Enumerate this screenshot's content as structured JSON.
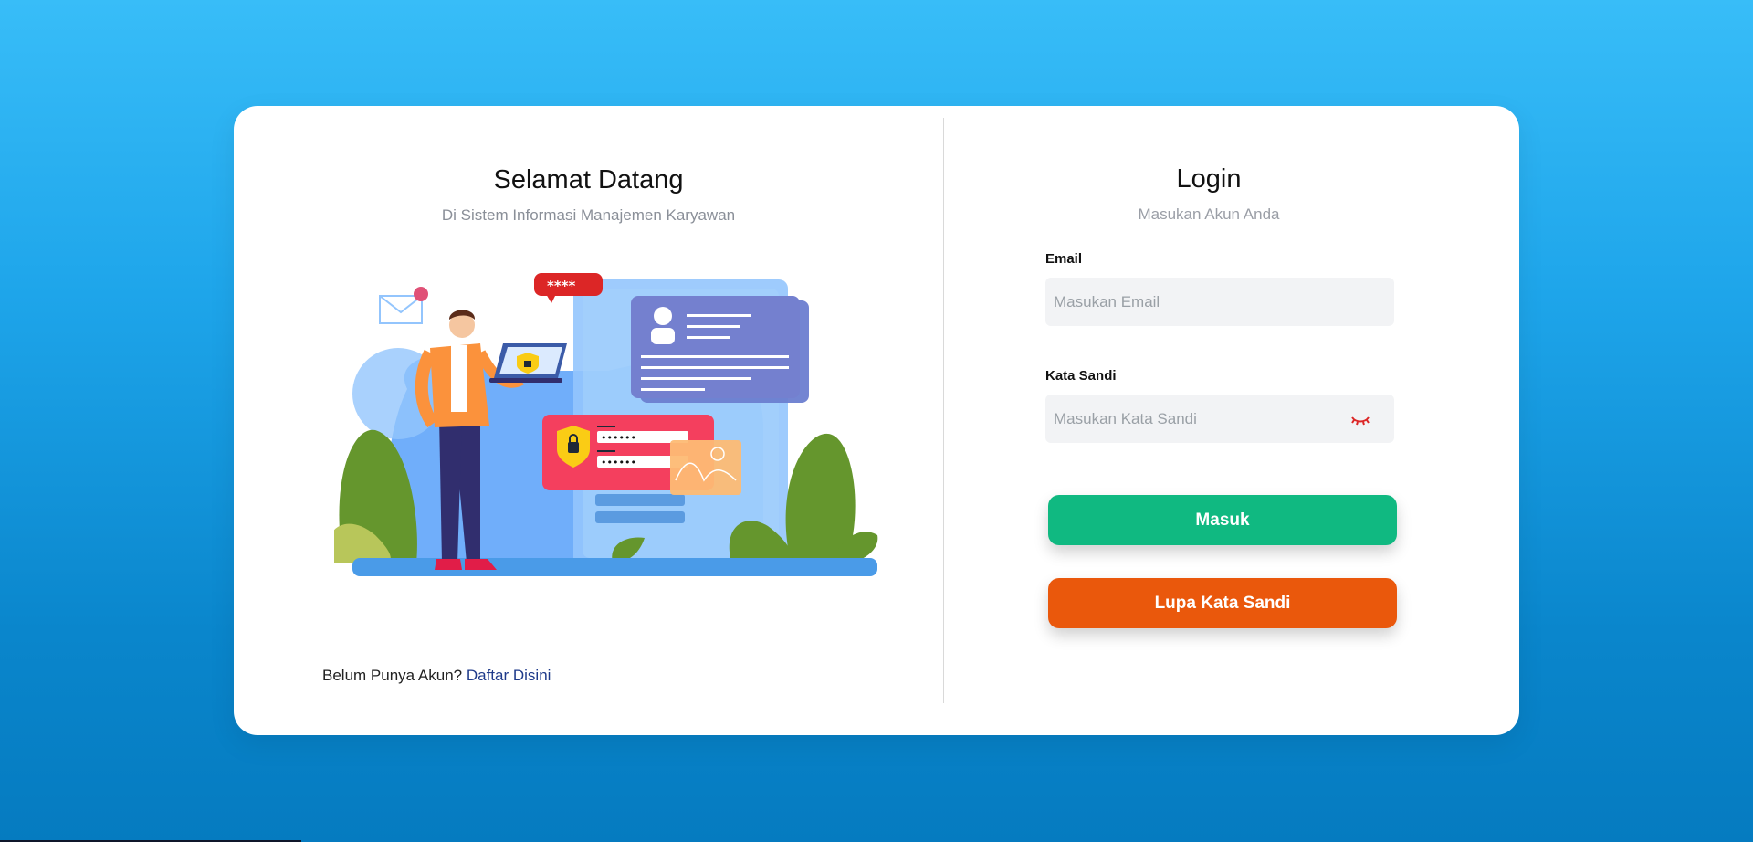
{
  "welcome": {
    "title": "Selamat Datang",
    "subtitle": "Di Sistem Informasi Manajemen Karyawan"
  },
  "illustration": {
    "password_bubble": "****",
    "password_dots": "••••••",
    "icon": "person-with-laptop-security-illustration"
  },
  "register": {
    "prompt": "Belum Punya Akun?",
    "link_label": "Daftar Disini"
  },
  "login": {
    "title": "Login",
    "subtitle": "Masukan Akun Anda",
    "email_label": "Email",
    "email_placeholder": "Masukan Email",
    "email_value": "",
    "password_label": "Kata Sandi",
    "password_placeholder": "Masukan Kata Sandi",
    "password_value": "",
    "password_toggle_icon": "eye-closed-icon",
    "submit_label": "Masuk",
    "forgot_label": "Lupa Kata Sandi"
  },
  "colors": {
    "background_top": "#38bdf8",
    "background_bottom": "#057bc0",
    "login_button": "#10b981",
    "forgot_button": "#ea580c",
    "link": "#1e3a8a"
  }
}
